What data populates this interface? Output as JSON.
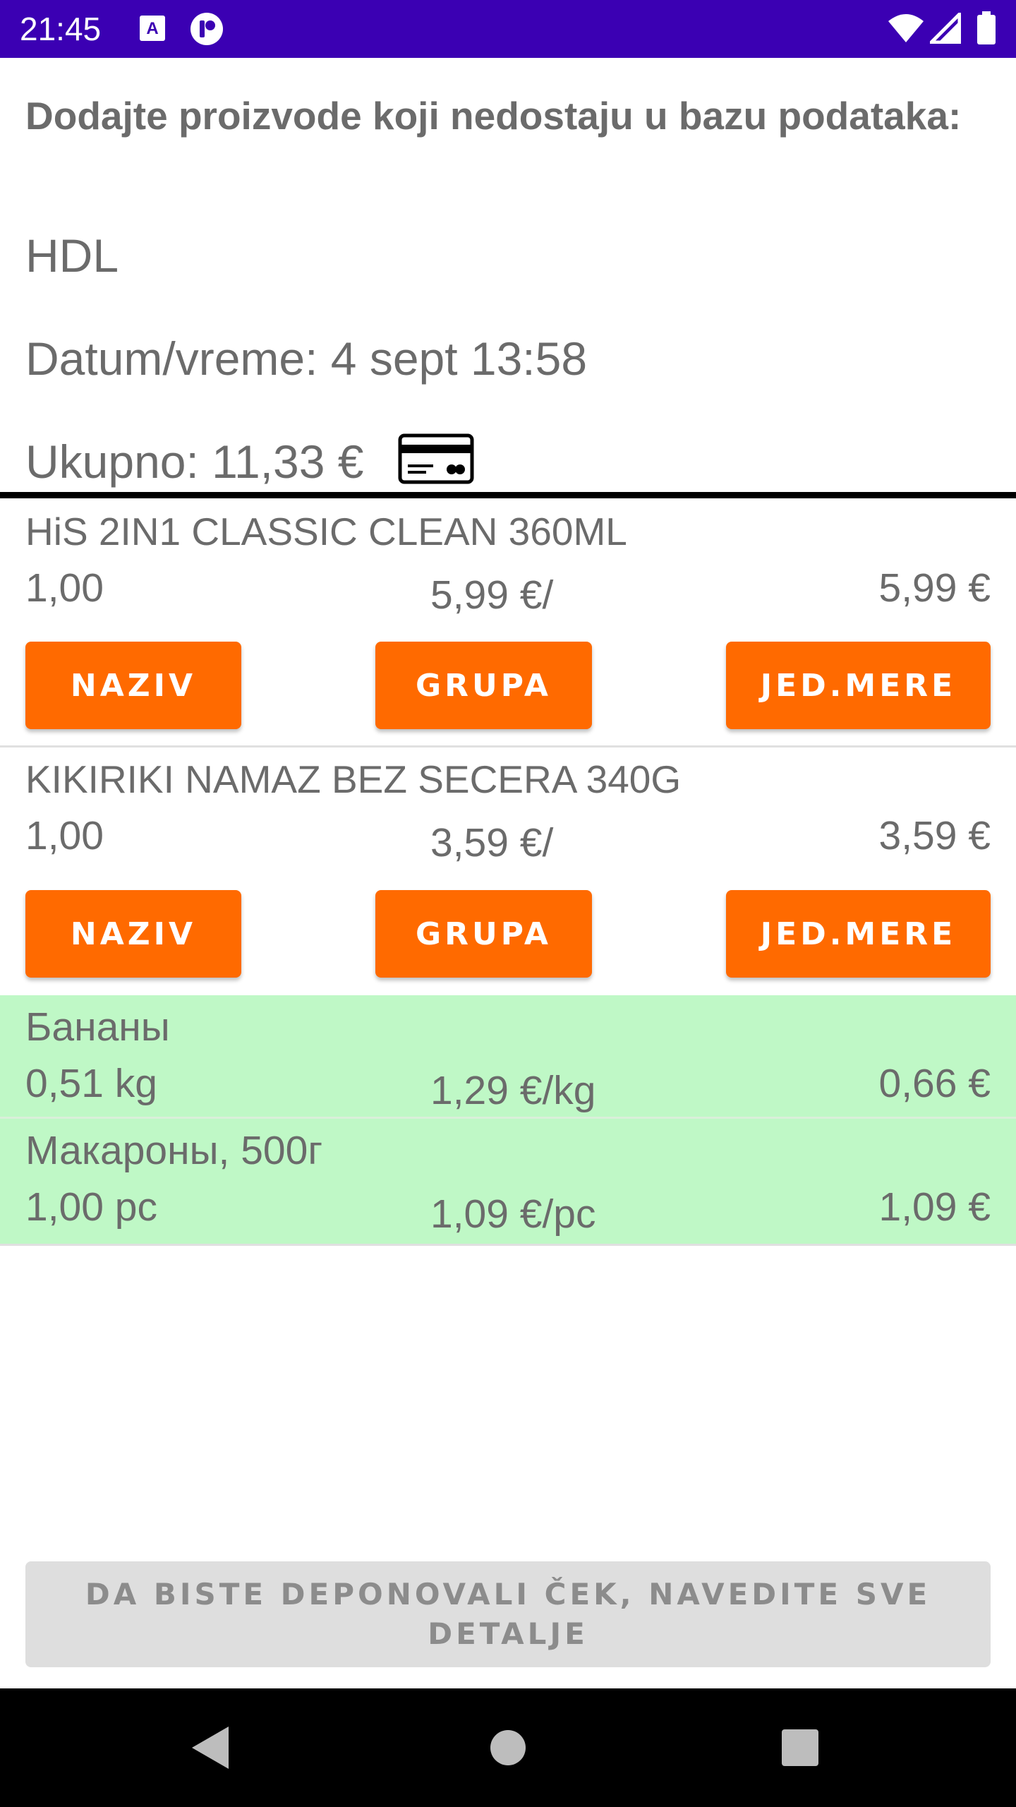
{
  "status_bar": {
    "time": "21:45"
  },
  "header": {
    "title": "Dodajte proizvode koji nedostaju u bazu podataka:"
  },
  "receipt": {
    "store": "HDL",
    "datetime": "Datum/vreme: 4 sept 13:58",
    "total": "Ukupno: 11,33 €",
    "payment_icon": "credit-card-icon"
  },
  "missing_items": [
    {
      "name": "HiS 2IN1 CLASSIC CLEAN 360ML",
      "qty": "1,00",
      "unit_price": "5,99 €/",
      "total": "5,99 €",
      "buttons": {
        "name": "NAZIV",
        "group": "GRUPA",
        "unit": "JED.MERE"
      }
    },
    {
      "name": "KIKIRIKI NAMAZ BEZ SECERA 340G",
      "qty": "1,00",
      "unit_price": "3,59 €/",
      "total": "3,59 €",
      "buttons": {
        "name": "NAZIV",
        "group": "GRUPA",
        "unit": "JED.MERE"
      }
    }
  ],
  "known_items": [
    {
      "name": "Бананы",
      "qty": "0,51 kg",
      "unit_price": "1,29 €/kg",
      "total": "0,66 €"
    },
    {
      "name": "Макароны, 500г",
      "qty": "1,00 pc",
      "unit_price": "1,09 €/pc",
      "total": "1,09 €"
    }
  ],
  "colors": {
    "status_bar": "#3b00b3",
    "button": "#ff6a00",
    "known_item_bg": "#bff8c6",
    "disabled_button": "#dedede"
  },
  "deposit_button": {
    "label": "DA BISTE DEPONOVALI ČEK, NAVEDITE SVE DETALJE",
    "enabled": false
  }
}
